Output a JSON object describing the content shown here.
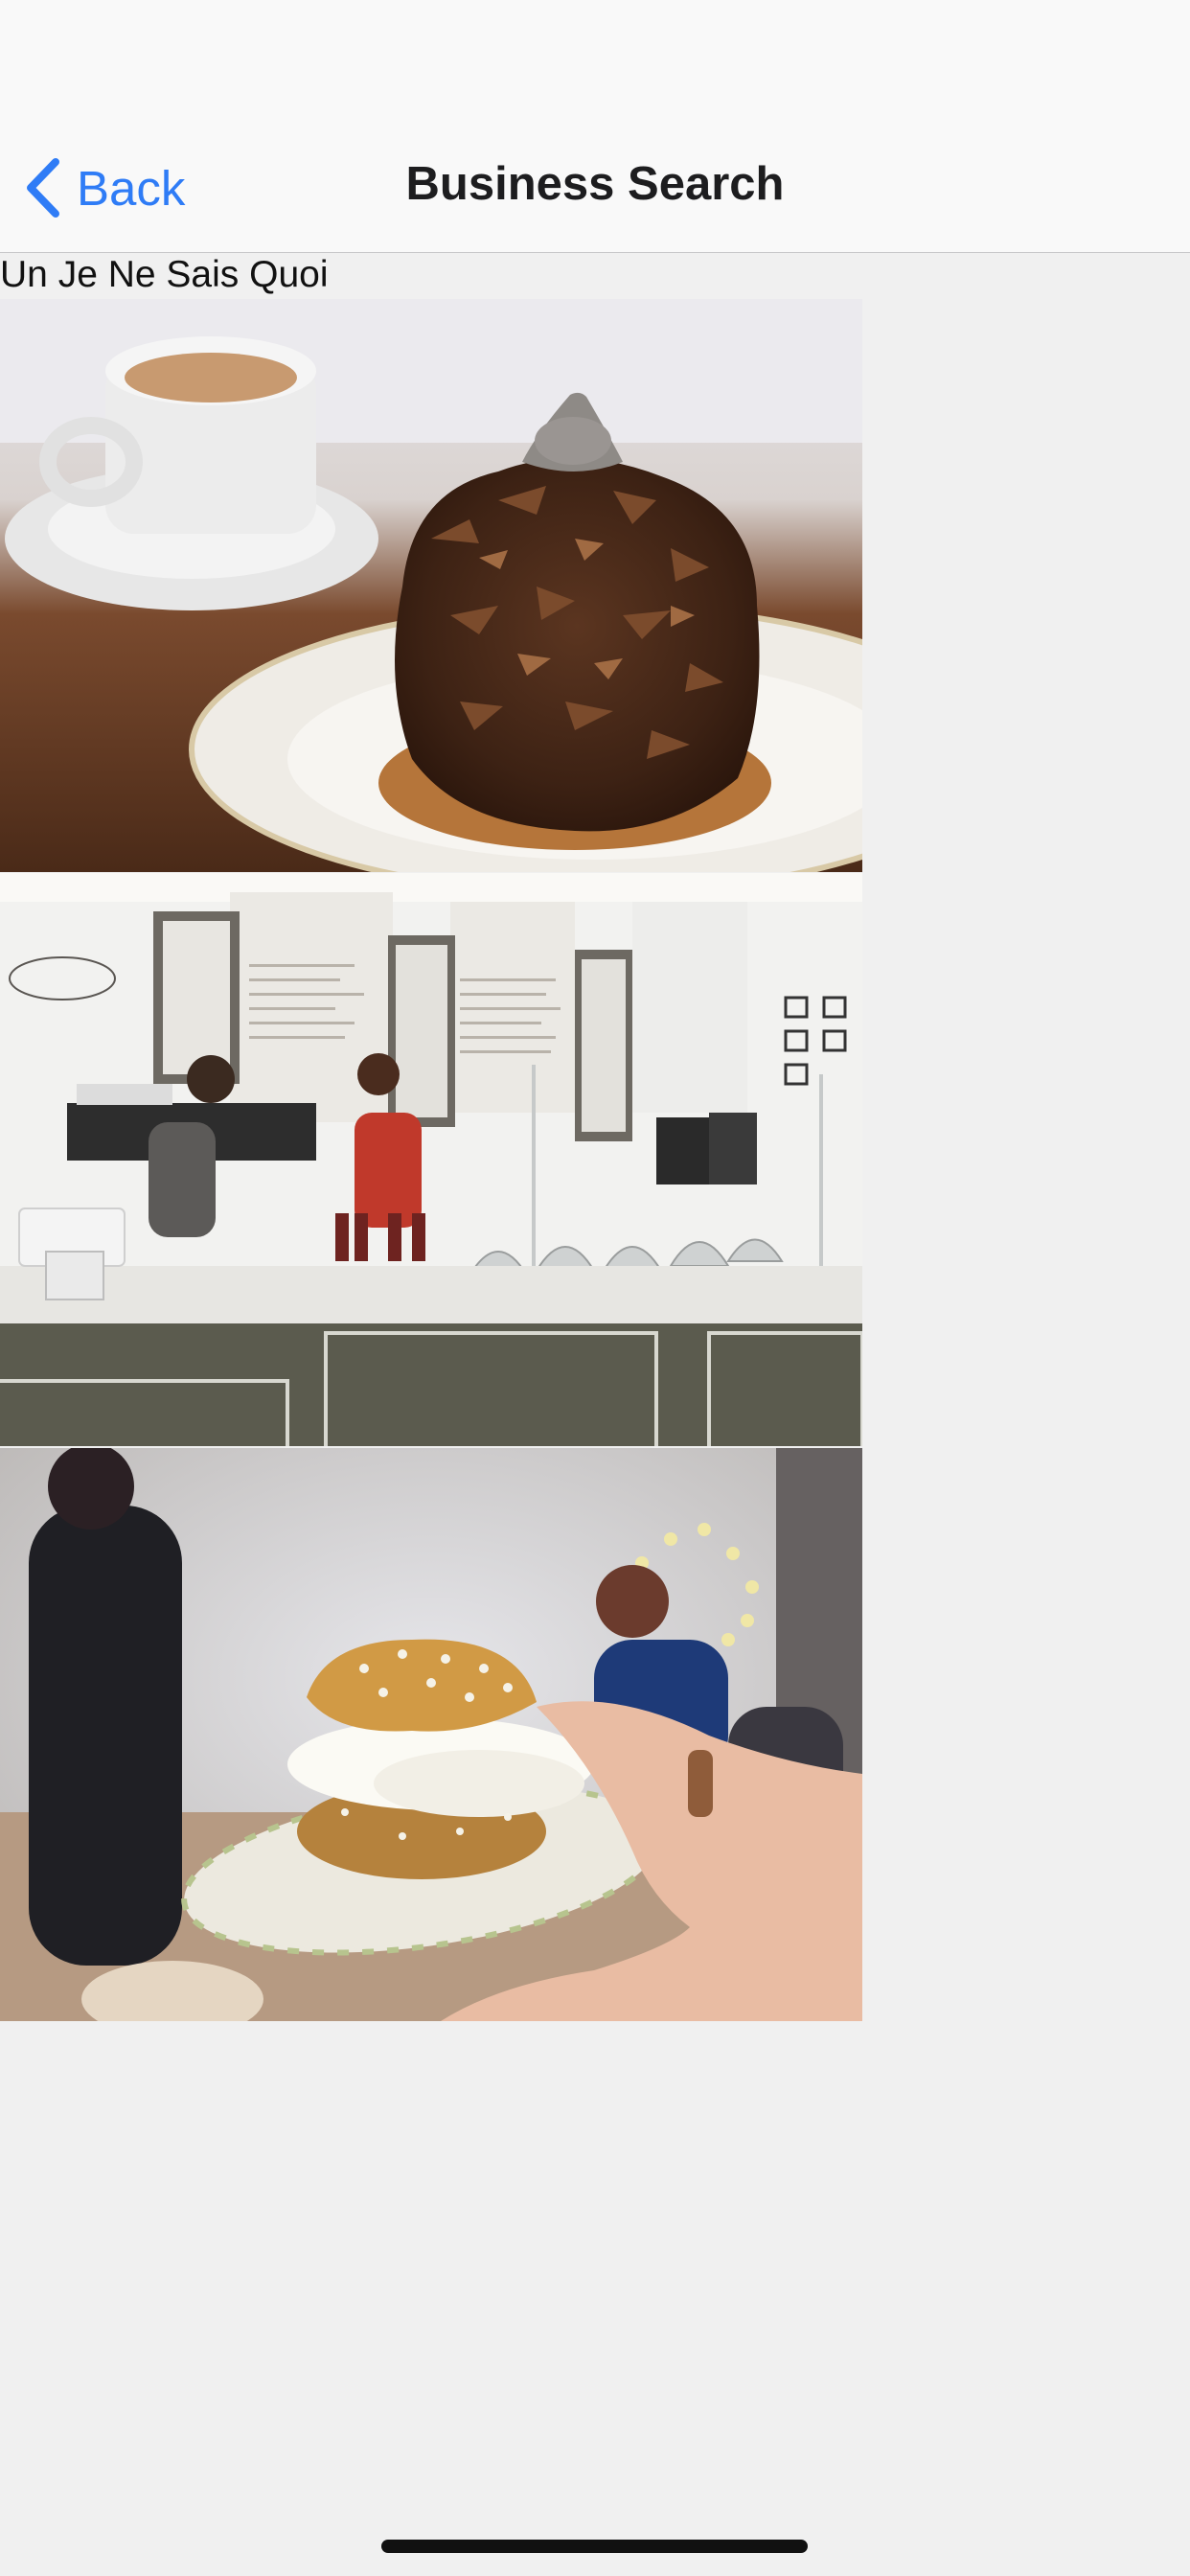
{
  "navbar": {
    "back_label": "Back",
    "title": "Business Search",
    "accent_color": "#2f7cf6",
    "back_icon": "chevron-left-icon"
  },
  "business": {
    "name": "Un Je Ne Sais Quoi"
  },
  "photos": [
    {
      "subject": "chocolate-pastry-photo"
    },
    {
      "subject": "cafe-counter-photo"
    },
    {
      "subject": "cream-puff-photo"
    }
  ]
}
